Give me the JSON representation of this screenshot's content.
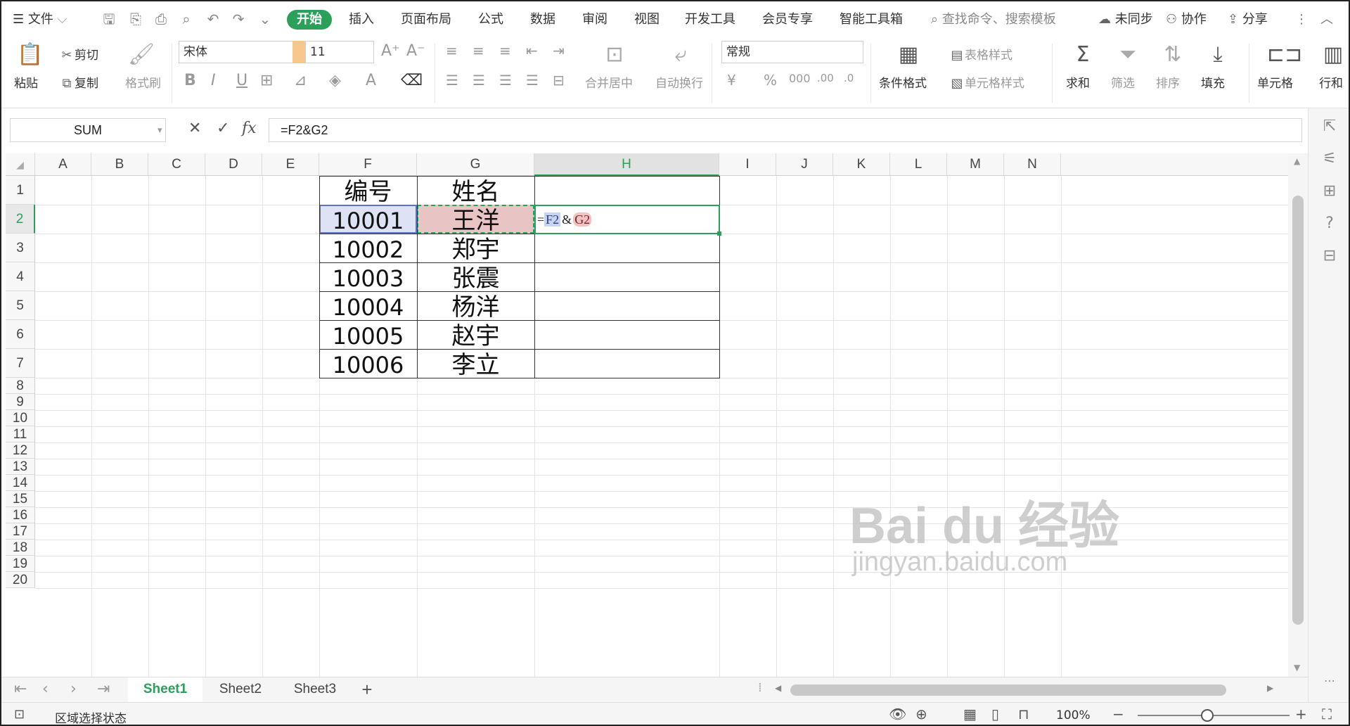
{
  "menubar": {
    "file_label": "文件",
    "tabs": [
      "开始",
      "插入",
      "页面布局",
      "公式",
      "数据",
      "审阅",
      "视图",
      "开发工具",
      "会员专享",
      "智能工具箱"
    ],
    "active_tab": "开始",
    "search_placeholder": "查找命令、搜索模板",
    "sync_label": "未同步",
    "collab_label": "协作",
    "share_label": "分享"
  },
  "ribbon": {
    "paste": "粘贴",
    "cut": "剪切",
    "copy": "复制",
    "format_painter": "格式刷",
    "font_name": "宋体",
    "font_size": "11",
    "merge_center": "合并居中",
    "wrap_text": "自动换行",
    "number_format": "常规",
    "conditional_format": "条件格式",
    "table_style": "表格样式",
    "cell_style": "单元格样式",
    "sum": "求和",
    "filter": "筛选",
    "sort": "排序",
    "fill": "填充",
    "cell": "单元格",
    "row_col": "行和"
  },
  "formula_bar": {
    "name_box": "SUM",
    "fx_label": "fx",
    "formula": "=F2&G2"
  },
  "sheet": {
    "columns": [
      "A",
      "B",
      "C",
      "D",
      "E",
      "F",
      "G",
      "H",
      "I",
      "J",
      "K",
      "L",
      "M",
      "N"
    ],
    "selected_column": "H",
    "selected_row": "2",
    "rows": [
      "1",
      "2",
      "3",
      "4",
      "5",
      "6",
      "7",
      "8",
      "9",
      "10",
      "11",
      "12",
      "13",
      "14",
      "15",
      "16",
      "17",
      "18",
      "19",
      "20"
    ],
    "table": {
      "headers": [
        "编号",
        "姓名"
      ],
      "data": [
        [
          "10001",
          "王洋"
        ],
        [
          "10002",
          "郑宇"
        ],
        [
          "10003",
          "张震"
        ],
        [
          "10004",
          "杨洋"
        ],
        [
          "10005",
          "赵宇"
        ],
        [
          "10006",
          "李立"
        ]
      ]
    },
    "editing_formula": {
      "eq": "=",
      "ref1": "F2",
      "op": "&",
      "ref2": "G2"
    }
  },
  "sheet_tabs": [
    "Sheet1",
    "Sheet2",
    "Sheet3"
  ],
  "active_sheet": "Sheet1",
  "status": {
    "mode": "区域选择状态",
    "zoom": "100%"
  },
  "watermark": {
    "brand": "Bai du 经验",
    "url": "jingyan.baidu.com"
  },
  "colors": {
    "accent_green": "#2ca05a",
    "ref_blue": "#c9d4ee",
    "ref_red": "#f0c2c2"
  }
}
